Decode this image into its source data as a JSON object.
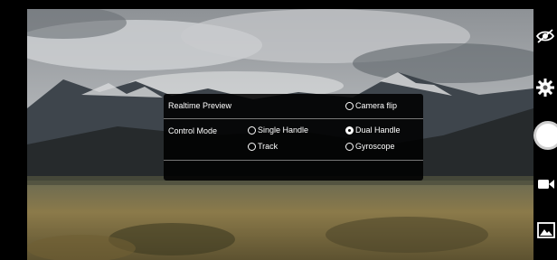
{
  "dialog": {
    "realtime_preview_label": "Realtime Preview",
    "camera_flip_label": "Camera flip",
    "control_mode_label": "Control Mode",
    "options": {
      "single_handle": "Single Handle",
      "dual_handle": "Dual Handle",
      "track": "Track",
      "gyroscope": "Gyroscope"
    },
    "selected_control_mode": "Dual Handle",
    "camera_flip_checked": false
  },
  "side_controls": {
    "icons": [
      "eye-slash-icon",
      "gear-icon",
      "shutter-button",
      "video-camera-icon",
      "gallery-icon"
    ]
  },
  "colors": {
    "dialog_bg": "#000000",
    "divider": "#777777",
    "text": "#ffffff"
  }
}
